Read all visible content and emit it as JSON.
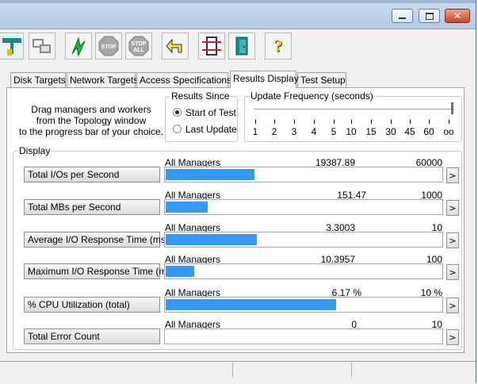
{
  "window": {
    "minimize_icon": "minimize-icon",
    "maximize_icon": "maximize-icon",
    "close_icon": "close-icon"
  },
  "toolbar": {
    "buttons": [
      {
        "icon": "topology-icon"
      },
      {
        "icon": "disconnect-icon"
      },
      {
        "icon": "start-green-flag-icon"
      },
      {
        "label": "STOP",
        "icon": "stop-icon"
      },
      {
        "label": "STOP",
        "label2": "ALL",
        "icon": "stop-all-icon"
      },
      {
        "icon": "reset-arrow-icon"
      },
      {
        "icon": "new-manager-icon"
      },
      {
        "icon": "exit-door-icon"
      },
      {
        "label": "?",
        "icon": "help-icon"
      }
    ]
  },
  "tabs": [
    "Disk Targets",
    "Network Targets",
    "Access Specifications",
    "Results Display",
    "Test Setup"
  ],
  "active_tab": "Results Display",
  "instructions": [
    "Drag managers and workers",
    "from the Topology window",
    "to the progress bar of your choice."
  ],
  "results_since": {
    "title": "Results Since",
    "options": [
      "Start of Test",
      "Last Update"
    ],
    "selected": "Start of Test"
  },
  "update_frequency": {
    "title": "Update Frequency (seconds)",
    "ticks": [
      "1",
      "2",
      "3",
      "4",
      "5",
      "10",
      "15",
      "30",
      "45",
      "60",
      "oo"
    ],
    "selected": "oo"
  },
  "display": {
    "title": "Display",
    "rows": [
      {
        "label": "Total I/Os per Second",
        "manager": "All Managers",
        "value": "19387.89",
        "max": "60000",
        "fraction": 0.323
      },
      {
        "label": "Total MBs per Second",
        "manager": "All Managers",
        "value": "151.47",
        "max": "1000",
        "fraction": 0.151
      },
      {
        "label": "Average I/O Response Time (ms)",
        "manager": "All Managers",
        "value": "3.3003",
        "max": "10",
        "fraction": 0.33
      },
      {
        "label": "Maximum I/O Response Time (ms)",
        "manager": "All Managers",
        "value": "10.3957",
        "max": "100",
        "fraction": 0.104
      },
      {
        "label": "% CPU Utilization (total)",
        "manager": "All Managers",
        "value": "6.17 %",
        "max": "10 %",
        "fraction": 0.617
      },
      {
        "label": "Total Error Count",
        "manager": "All Managers",
        "value": "0",
        "max": "10",
        "fraction": 0
      }
    ],
    "arrow_label": ">"
  },
  "colors": {
    "bar": "#3399ff",
    "close_button": "#c8452c"
  }
}
